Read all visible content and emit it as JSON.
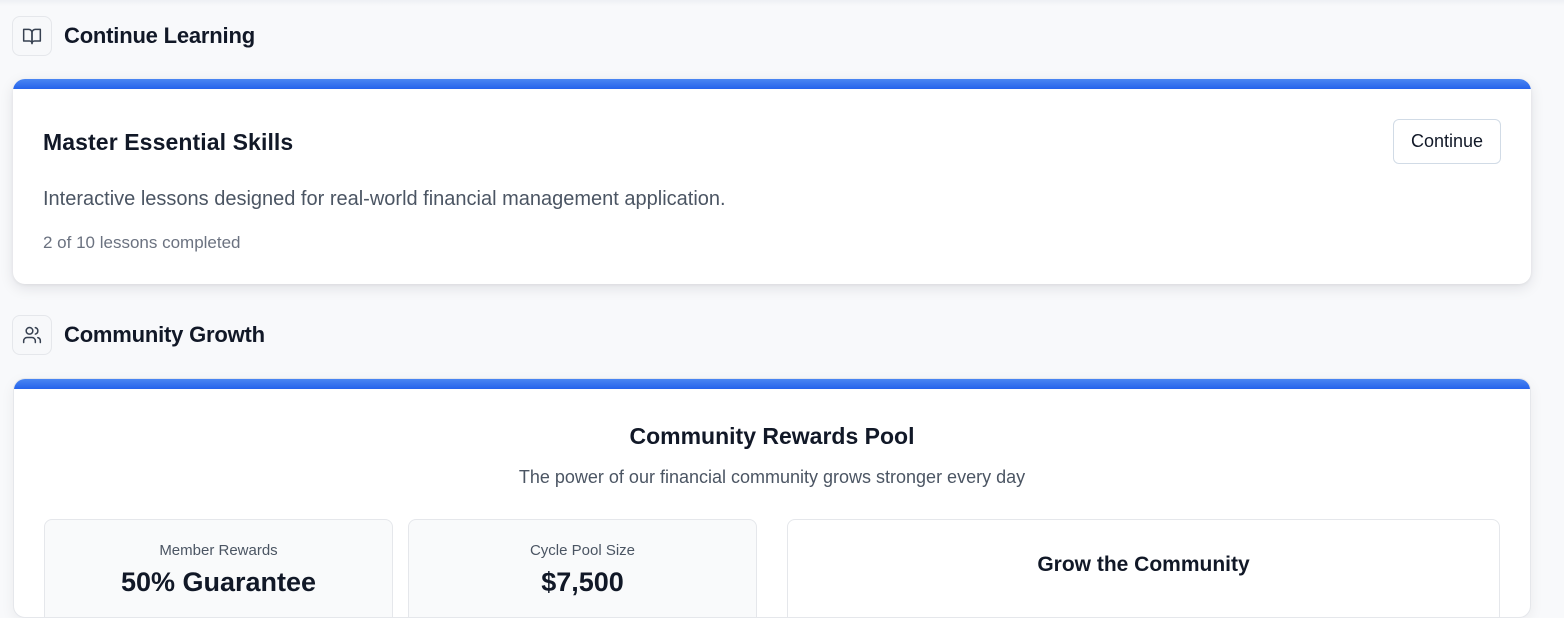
{
  "icons": {
    "learning": "book-open-icon",
    "community": "users-icon"
  },
  "colors": {
    "accent": "#2563eb",
    "background": "#f8f9fb"
  },
  "continue_learning": {
    "section_title": "Continue Learning",
    "course_title": "Master Essential Skills",
    "description": "Interactive lessons designed for real-world financial management application.",
    "progress_text": "2 of 10 lessons completed",
    "continue_label": "Continue"
  },
  "community_growth": {
    "section_title": "Community Growth",
    "pool_title": "Community Rewards Pool",
    "pool_subtitle": "The power of our financial community grows stronger every day",
    "stats": [
      {
        "label": "Member Rewards",
        "value": "50% Guarantee"
      },
      {
        "label": "Cycle Pool Size",
        "value": "$7,500"
      }
    ],
    "grow_title": "Grow the Community"
  }
}
